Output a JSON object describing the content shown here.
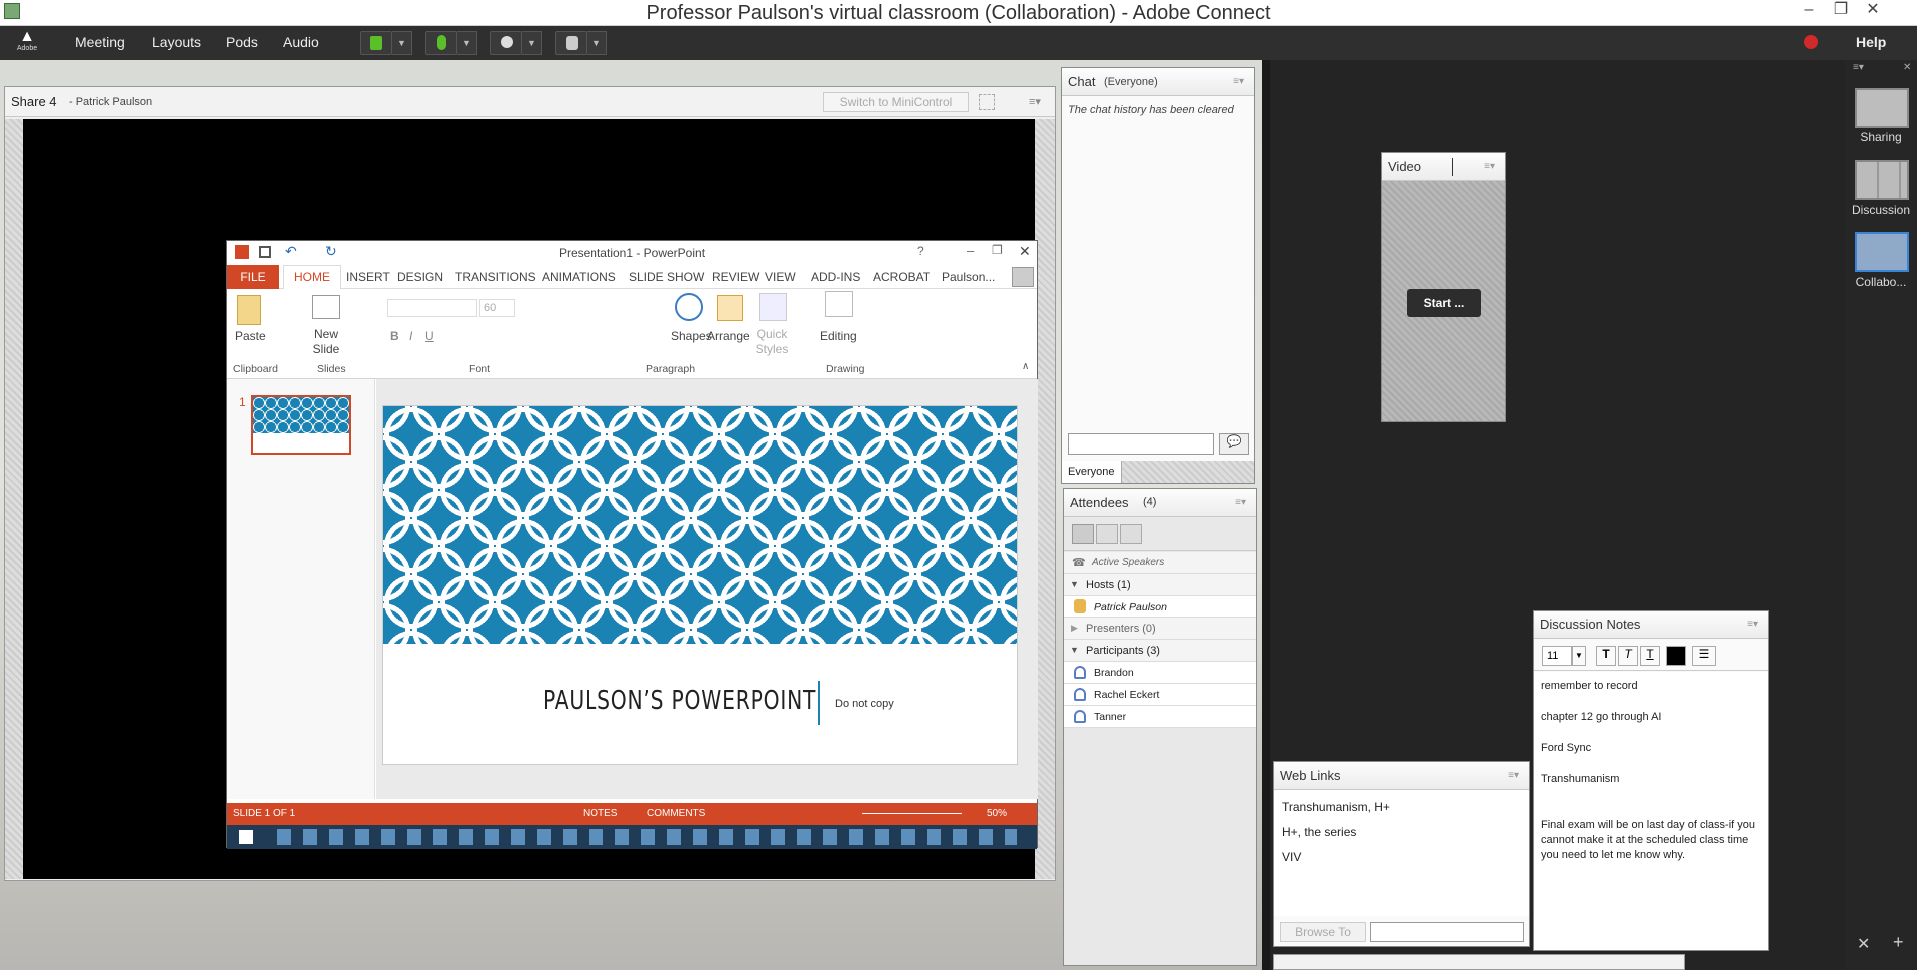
{
  "window": {
    "title": "Professor Paulson's virtual classroom (Collaboration) - Adobe Connect"
  },
  "menubar": {
    "logo": "Adobe",
    "items": [
      "Meeting",
      "Layouts",
      "Pods",
      "Audio"
    ],
    "help": "Help"
  },
  "share_pod": {
    "title": "Share 4",
    "presenter": "- Patrick Paulson",
    "mini_control": "Switch to MiniControl"
  },
  "powerpoint": {
    "title": "Presentation1 - PowerPoint",
    "file_tab": "FILE",
    "tabs": [
      "HOME",
      "INSERT",
      "DESIGN",
      "TRANSITIONS",
      "ANIMATIONS",
      "SLIDE SHOW",
      "REVIEW",
      "VIEW",
      "ADD-INS",
      "ACROBAT"
    ],
    "user": "Paulson...",
    "ribbon": {
      "paste": "Paste",
      "new_slide": "New Slide",
      "font_size": "60",
      "shapes": "Shapes",
      "arrange": "Arrange",
      "quick_styles": "Quick Styles",
      "editing": "Editing",
      "groups": [
        "Clipboard",
        "Slides",
        "Font",
        "Paragraph",
        "Drawing"
      ]
    },
    "slide_number": "1",
    "slide_title": "PAULSON’S POWERPOINT",
    "slide_subtitle": "Do not copy",
    "status": {
      "slide": "SLIDE 1 OF 1",
      "notes": "NOTES",
      "comments": "COMMENTS",
      "zoom": "50%"
    }
  },
  "chat": {
    "title": "Chat",
    "scope": "(Everyone)",
    "history": "The chat history has been cleared",
    "tab": "Everyone"
  },
  "attendees": {
    "title": "Attendees",
    "count": "(4)",
    "active_speakers": "Active Speakers",
    "hosts_label": "Hosts (1)",
    "hosts": [
      "Patrick Paulson"
    ],
    "presenters_label": "Presenters (0)",
    "participants_label": "Participants (3)",
    "participants": [
      "Brandon",
      "Rachel Eckert",
      "Tanner"
    ]
  },
  "video": {
    "title": "Video",
    "start": "Start ..."
  },
  "web_links": {
    "title": "Web Links",
    "links": [
      "Transhumanism, H+",
      "H+, the series",
      "VIV"
    ],
    "browse": "Browse To"
  },
  "discussion_notes": {
    "title": "Discussion Notes",
    "font_size": "11",
    "lines": [
      "remember to record",
      "chapter 12 go through AI",
      "Ford Sync",
      "Transhumanism",
      "Final exam will be on last day of class-if you cannot make it at the scheduled class time you need to let me know why."
    ]
  },
  "layouts": [
    "Sharing",
    "Discussion",
    "Collabo..."
  ],
  "colors": {
    "ppt_accent": "#d24726",
    "pattern_blue": "#1a83b3",
    "selected_layout": "#3a84d8"
  }
}
